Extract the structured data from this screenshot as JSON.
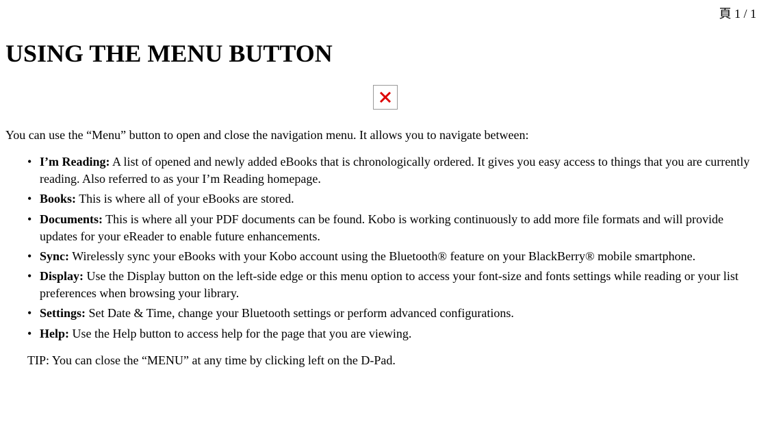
{
  "page_indicator": "頁 1 / 1",
  "title": "USING THE MENU BUTTON",
  "intro": "You can use the “Menu” button to open and close the navigation menu. It allows you to navigate between:",
  "items": [
    {
      "title": "I’m Reading:",
      "desc": " A list of opened and newly added eBooks that is chronologically ordered. It gives you easy access to things that you are currently reading. Also referred to as your I’m Reading homepage."
    },
    {
      "title": "Books:",
      "desc": " This is where all of your eBooks are stored."
    },
    {
      "title": "Documents:",
      "desc": " This is where all your PDF documents can be found. Kobo is working continuously to add more file formats and will provide updates for your eReader to enable future enhancements."
    },
    {
      "title": "Sync:",
      "desc": " Wirelessly sync your eBooks with your Kobo account using the Bluetooth® feature on your BlackBerry® mobile smartphone."
    },
    {
      "title": "Display:",
      "desc": " Use the Display button on the left-side edge or this menu option to access your font-size and fonts settings while reading or your list preferences when browsing your library."
    },
    {
      "title": "Settings:",
      "desc": " Set Date & Time, change your Bluetooth settings or perform advanced configurations."
    },
    {
      "title": "Help:",
      "desc": " Use the Help button to access help for the page that you are viewing."
    }
  ],
  "tip": "TIP: You can close the “MENU” at any time by clicking left on the D-Pad."
}
